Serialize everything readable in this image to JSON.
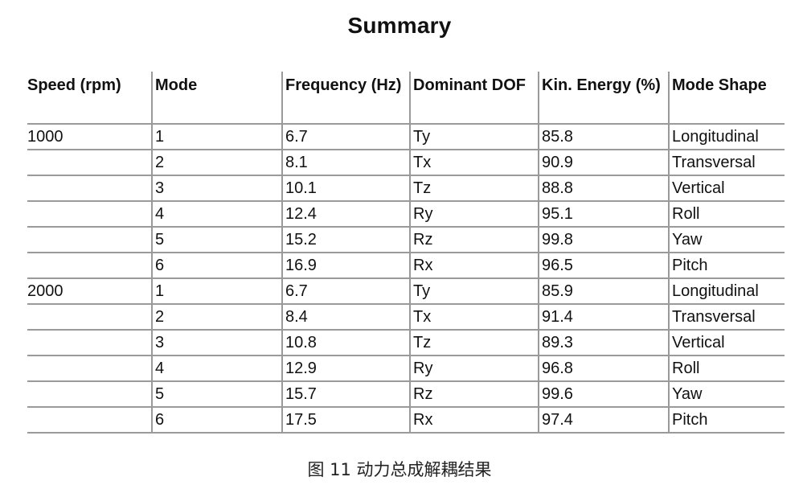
{
  "title": "Summary",
  "table": {
    "headers": [
      "Speed (rpm)",
      "Mode",
      "Frequency (Hz)",
      "Dominant DOF",
      "Kin. Energy (%)",
      "Mode Shape"
    ],
    "rows": [
      [
        "1000",
        "1",
        "6.7",
        "Ty",
        "85.8",
        "Longitudinal"
      ],
      [
        "",
        "2",
        "8.1",
        "Tx",
        "90.9",
        "Transversal"
      ],
      [
        "",
        "3",
        "10.1",
        "Tz",
        "88.8",
        "Vertical"
      ],
      [
        "",
        "4",
        "12.4",
        "Ry",
        "95.1",
        "Roll"
      ],
      [
        "",
        "5",
        "15.2",
        "Rz",
        "99.8",
        "Yaw"
      ],
      [
        "",
        "6",
        "16.9",
        "Rx",
        "96.5",
        "Pitch"
      ],
      [
        "2000",
        "1",
        "6.7",
        "Ty",
        "85.9",
        "Longitudinal"
      ],
      [
        "",
        "2",
        "8.4",
        "Tx",
        "91.4",
        "Transversal"
      ],
      [
        "",
        "3",
        "10.8",
        "Tz",
        "89.3",
        "Vertical"
      ],
      [
        "",
        "4",
        "12.9",
        "Ry",
        "96.8",
        "Roll"
      ],
      [
        "",
        "5",
        "15.7",
        "Rz",
        "99.6",
        "Yaw"
      ],
      [
        "",
        "6",
        "17.5",
        "Rx",
        "97.4",
        "Pitch"
      ]
    ]
  },
  "caption": "图 11  动力总成解耦结果"
}
